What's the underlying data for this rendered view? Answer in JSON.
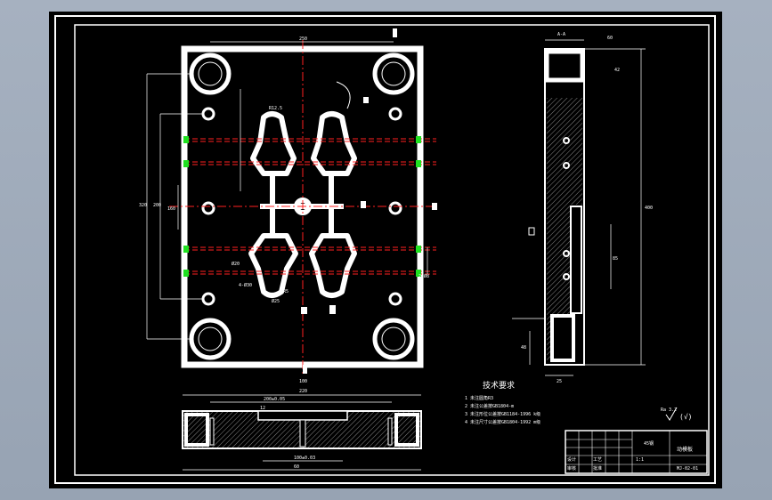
{
  "drawing": {
    "tech_title": "技术要求",
    "notes": [
      "1 未注圆角R3",
      "2 未注公差按GB1804-m",
      "3 未注形位公差按GB1184-1996 k级",
      "4 未注尺寸公差按GB1804-1992 m级"
    ],
    "roughness": "Ra 3.2",
    "dims_front": [
      "250",
      "320",
      "200",
      "160",
      "R12.5",
      "Ø20",
      "4-Ø30",
      "R5",
      "2-Ø8",
      "Ø25",
      "100"
    ],
    "dims_side": [
      "A-A",
      "42",
      "60",
      "400",
      "85",
      "25",
      "48"
    ],
    "dims_bottom": [
      "220",
      "200±0.05",
      "100±0.03",
      "12",
      "60"
    ],
    "title_block": {
      "part_name": "动模板",
      "material": "45钢",
      "scale": "1:1",
      "drawing_no": "MJ-02-01",
      "rows": [
        "设计",
        "审核",
        "工艺",
        "批准"
      ]
    }
  },
  "colors": {
    "frame": "#ffffff",
    "center_line": "#ff2020",
    "dimension": "#ffffff",
    "hole_marker": "#20e020",
    "hatch": "#8a8a8a",
    "background": "#000000"
  }
}
